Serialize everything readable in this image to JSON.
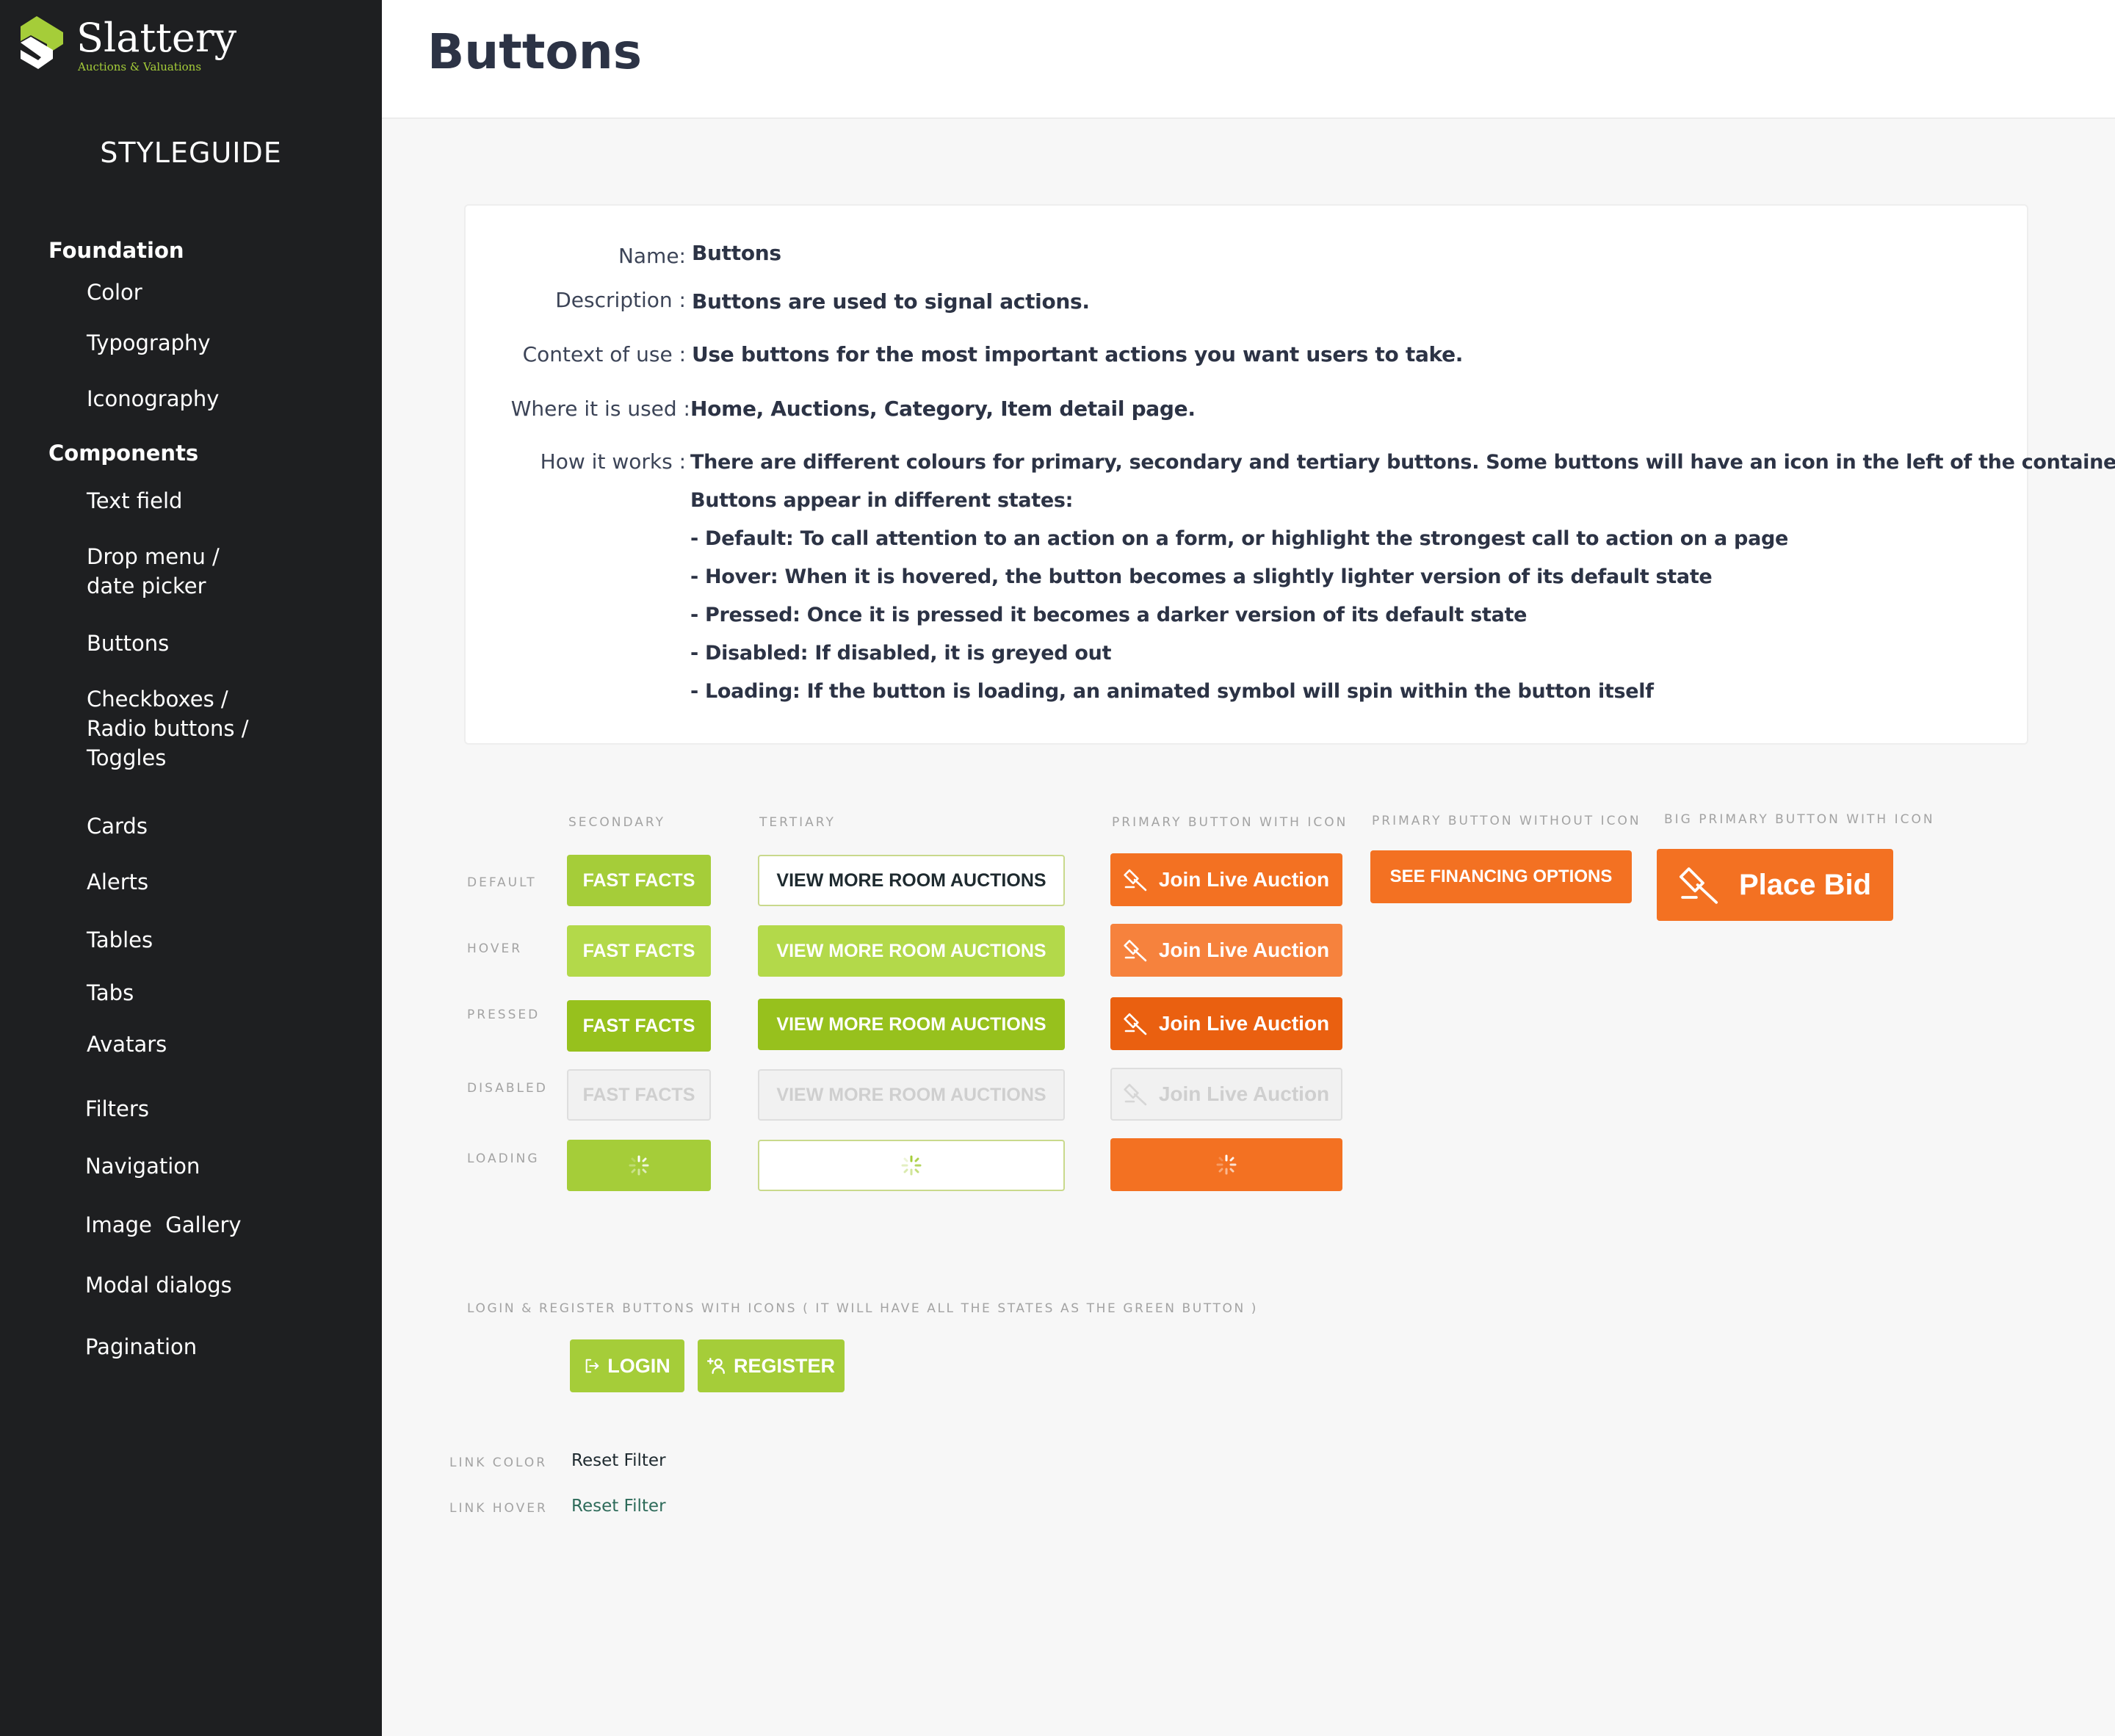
{
  "brand": {
    "name": "Slattery",
    "tagline": "Auctions & Valuations"
  },
  "sidebar": {
    "title": "STYLEGUIDE",
    "sections": [
      {
        "label": "Foundation",
        "items": [
          "Color",
          "Typography",
          "Iconography"
        ]
      },
      {
        "label": "Components",
        "items": [
          "Text field",
          "Drop menu / date picker",
          "Buttons",
          "Checkboxes / Radio buttons / Toggles",
          "Cards",
          "Alerts",
          "Tables",
          "Tabs",
          "Avatars",
          "Filters",
          "Navigation",
          "Image  Gallery",
          "Modal dialogs",
          "Pagination"
        ]
      }
    ]
  },
  "header": {
    "title": "Buttons"
  },
  "info": {
    "name_label": "Name:",
    "name_value": "Buttons",
    "description_label": "Description :",
    "description_value": "Buttons are used to signal actions.",
    "context_label": "Context of use :",
    "context_value": "Use buttons for the most important actions you want users to take.",
    "where_label": "Where it is used :",
    "where_value": "Home, Auctions, Category, Item detail page.",
    "how_label": "How it works :",
    "how_lines": [
      "There are different colours for primary, secondary and tertiary buttons. Some buttons will have an icon in the left of the container.",
      "Buttons appear in different states:",
      "- Default: To call attention to an action on a form, or highlight the strongest call to action on a page",
      "- Hover:  When it is hovered, the button becomes a slightly lighter version of its default state",
      "- Pressed: Once it is pressed it becomes a darker version of its default state",
      "- Disabled: If disabled, it is greyed out",
      "- Loading:  If the button is loading, an animated symbol will spin within the button itself"
    ]
  },
  "grid": {
    "columns": [
      "SECONDARY",
      "TERTIARY",
      "PRIMARY BUTTON WITH ICON",
      "PRIMARY BUTTON WITHOUT ICON",
      "BIG PRIMARY BUTTON WITH ICON"
    ],
    "rows": [
      "DEFAULT",
      "HOVER",
      "PRESSED",
      "DISABLED",
      "LOADING"
    ],
    "secondary_label": "FAST FACTS",
    "tertiary_label": "VIEW MORE ROOM AUCTIONS",
    "primary_icon_label": "Join Live Auction",
    "primary_noicon_label": "SEE FINANCING OPTIONS",
    "big_primary_label": "Place Bid"
  },
  "auth": {
    "caption": "LOGIN & REGISTER BUTTONS WITH ICONS ( IT WILL HAVE ALL THE STATES AS THE GREEN BUTTON )",
    "login_label": "LOGIN",
    "register_label": "REGISTER"
  },
  "links": {
    "color_caption": "LINK COLOR",
    "hover_caption": "LINK HOVER",
    "link_text": "Reset Filter"
  },
  "colors": {
    "green": "#a5cd39",
    "green_hover": "#b3d94a",
    "green_pressed": "#97c11d",
    "orange": "#f37122",
    "orange_hover": "#f6823d",
    "orange_pressed": "#ea6010",
    "sidebar": "#1e1f21",
    "link": "#1e2a2f",
    "link_hover": "#2e6b5a"
  },
  "icons": [
    "gavel-icon",
    "login-icon",
    "add-user-icon",
    "spinner-icon"
  ]
}
